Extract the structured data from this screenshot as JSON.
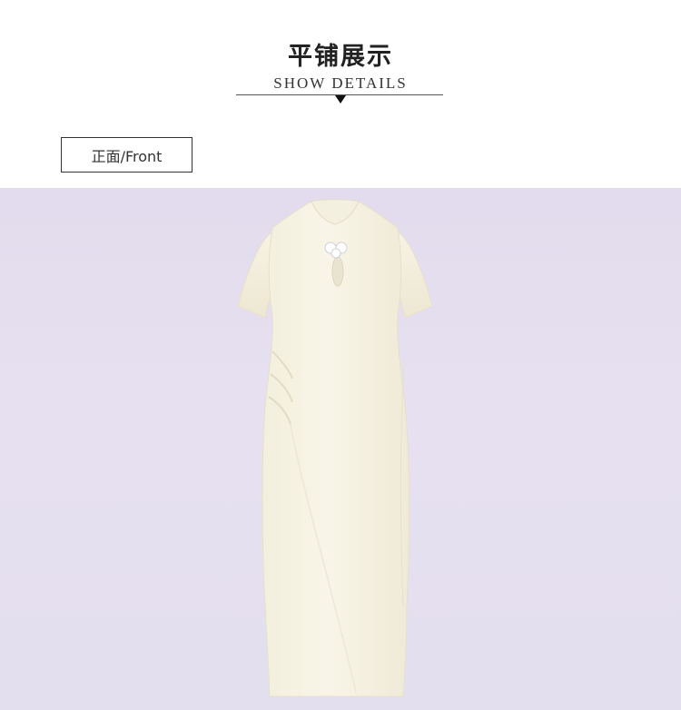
{
  "header": {
    "title_cn": "平铺展示",
    "title_en": "SHOW DETAILS"
  },
  "view": {
    "label": "正面/Front"
  },
  "photo": {
    "subject": "white short-sleeve cheongsam dress, flat lay",
    "background_color": "#e4dfee",
    "dress_color": "#f5f1e2"
  }
}
